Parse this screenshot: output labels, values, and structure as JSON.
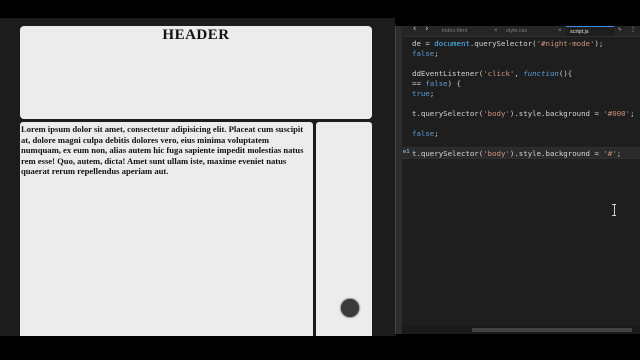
{
  "preview": {
    "header_title": "HEADER",
    "main_text": "Lorem ipsum dolor sit amet, consectetur adipisicing elit. Placeat cum suscipit at, dolore magni culpa debitis dolores vero, eius minima voluptatem numquam, ex eum non, alias autem hic fuga sapiente impedit molestias natus rem esse! Quo, autem, dicta! Amet sunt ullam iste, maxime eveniet natus quaerat rerum repellendus aperiam aut."
  },
  "editor": {
    "tabs": [
      {
        "label": "index.html",
        "active": false
      },
      {
        "label": "style.css",
        "active": false
      },
      {
        "label": "script.js",
        "active": true
      }
    ],
    "current_line_badge": "e1",
    "code_lines": [
      [
        {
          "t": "de = ",
          "c": "plain"
        },
        {
          "t": "document",
          "c": "obj"
        },
        {
          "t": ".querySelector(",
          "c": "plain"
        },
        {
          "t": "'#night-mode'",
          "c": "str"
        },
        {
          "t": ");",
          "c": "plain"
        }
      ],
      [
        {
          "t": "false",
          "c": "kw"
        },
        {
          "t": ";",
          "c": "plain"
        }
      ],
      [],
      [
        {
          "t": "ddEventListener(",
          "c": "plain"
        },
        {
          "t": "'click'",
          "c": "str"
        },
        {
          "t": ", ",
          "c": "plain"
        },
        {
          "t": "function",
          "c": "fn-italic"
        },
        {
          "t": "(){",
          "c": "plain"
        }
      ],
      [
        {
          "t": "== ",
          "c": "plain"
        },
        {
          "t": "false",
          "c": "kw"
        },
        {
          "t": ") {",
          "c": "plain"
        }
      ],
      [
        {
          "t": "true",
          "c": "kw"
        },
        {
          "t": ";",
          "c": "plain"
        }
      ],
      [],
      [
        {
          "t": "t.querySelector(",
          "c": "plain"
        },
        {
          "t": "'body'",
          "c": "str"
        },
        {
          "t": ").style.background = ",
          "c": "plain"
        },
        {
          "t": "'#000'",
          "c": "str"
        },
        {
          "t": ";",
          "c": "plain"
        }
      ],
      [],
      [
        {
          "t": "false",
          "c": "kw"
        },
        {
          "t": ";",
          "c": "plain"
        }
      ],
      [],
      [
        {
          "t": "t.querySelector(",
          "c": "plain"
        },
        {
          "t": "'body'",
          "c": "str"
        },
        {
          "t": ").style.background = ",
          "c": "plain"
        },
        {
          "t": "'#'",
          "c": "str"
        },
        {
          "t": ";",
          "c": "plain"
        }
      ]
    ]
  }
}
